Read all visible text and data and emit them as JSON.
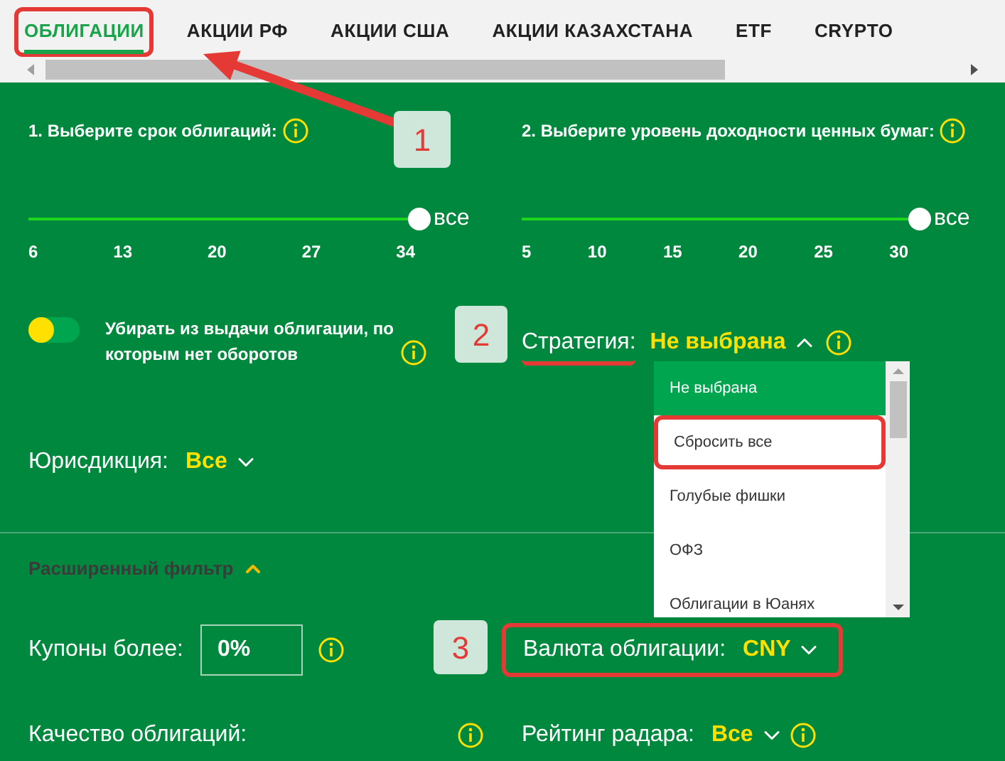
{
  "tabs": [
    {
      "label": "ОБЛИГАЦИИ",
      "selected": true,
      "highlighted": true
    },
    {
      "label": "АКЦИИ РФ",
      "selected": false,
      "highlighted": false
    },
    {
      "label": "АКЦИИ США",
      "selected": false,
      "highlighted": false
    },
    {
      "label": "АКЦИИ КАЗАХСТАНА",
      "selected": false,
      "highlighted": false
    },
    {
      "label": "ETF",
      "selected": false,
      "highlighted": false
    },
    {
      "label": "CRYPTO",
      "selected": false,
      "highlighted": false
    }
  ],
  "term_filter": {
    "title": "1. Выберите срок облигаций:",
    "level": 1,
    "value_label": "все",
    "ticks": [
      "6",
      "13",
      "20",
      "27",
      "34"
    ]
  },
  "yield_filter": {
    "title": "2. Выберите уровень доходности ценных бумаг:",
    "level": 1,
    "value_label": "все",
    "ticks": [
      "5",
      "10",
      "15",
      "20",
      "25",
      "30"
    ]
  },
  "toggle": {
    "label": "Убирать из выдачи облигации, по которым нет оборотов",
    "on": false
  },
  "strategy": {
    "label": "Стратегия:",
    "value": "Не выбрана",
    "expanded": true,
    "underlined": true,
    "options": [
      {
        "label": "Не выбрана",
        "selected": true,
        "highlighted": false
      },
      {
        "label": "Сбросить все",
        "selected": false,
        "highlighted": true
      },
      {
        "label": "Голубые фишки",
        "selected": false,
        "highlighted": false
      },
      {
        "label": "ОФЗ",
        "selected": false,
        "highlighted": false
      },
      {
        "label": "Облигации в Юанях",
        "selected": false,
        "highlighted": false
      }
    ]
  },
  "jurisdiction": {
    "label": "Юрисдикция:",
    "value": "Все"
  },
  "advanced_filter": {
    "label": "Расширенный фильтр",
    "expanded": true
  },
  "coupons": {
    "label": "Купоны более:",
    "value": "0%"
  },
  "currency": {
    "label": "Валюта облигации:",
    "value": "CNY",
    "highlighted": true
  },
  "quality": {
    "label": "Качество облигаций:"
  },
  "radar_rating": {
    "label": "Рейтинг радара:",
    "value": "Все"
  },
  "annotations": [
    {
      "number": "1"
    },
    {
      "number": "2"
    },
    {
      "number": "3"
    }
  ]
}
